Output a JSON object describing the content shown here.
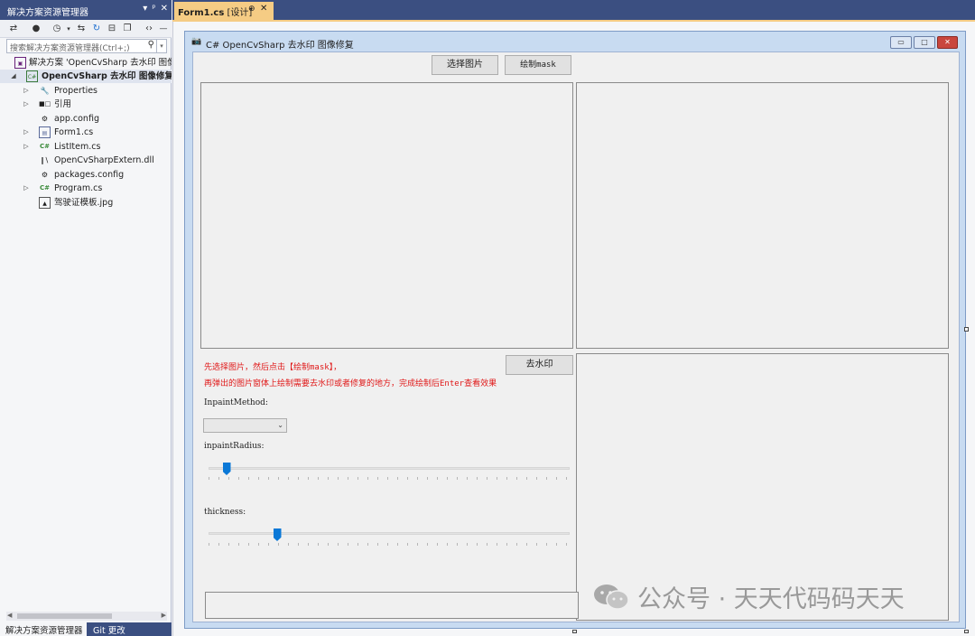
{
  "solution_explorer": {
    "title": "解决方案资源管理器",
    "title_buttons": [
      "▾",
      "ᵖ",
      "✕"
    ],
    "search_placeholder": "搜索解决方案资源管理器(Ctrl+;)",
    "tree": [
      {
        "label": "解决方案 'OpenCvSharp 去水印 图像",
        "icon": "solution-icon"
      },
      {
        "label": "OpenCvSharp 去水印 图像修复",
        "icon": "csharp-project-icon",
        "expanded": true,
        "bold": true
      },
      {
        "label": "Properties",
        "icon": "wrench-icon"
      },
      {
        "label": "引用",
        "icon": "references-icon"
      },
      {
        "label": "app.config",
        "icon": "config-file-icon"
      },
      {
        "label": "Form1.cs",
        "icon": "form-icon"
      },
      {
        "label": "ListItem.cs",
        "icon": "csharp-file-icon"
      },
      {
        "label": "OpenCvSharpExtern.dll",
        "icon": "dll-icon"
      },
      {
        "label": "packages.config",
        "icon": "config-file-icon"
      },
      {
        "label": "Program.cs",
        "icon": "csharp-file-icon"
      },
      {
        "label": "驾驶证模板.jpg",
        "icon": "image-file-icon"
      }
    ],
    "bottom_tabs": [
      "解决方案资源管理器",
      "Git 更改"
    ]
  },
  "document_tab": {
    "file": "Form1.cs",
    "suffix": " [设计]",
    "pin": "⊕",
    "close": "✕"
  },
  "form": {
    "title": "C# OpenCvSharp 去水印 图像修复",
    "window_buttons": [
      "▭",
      "□",
      "✕"
    ],
    "select_image_button": "选择图片",
    "draw_mask_button": "绘制mask",
    "remove_watermark_button": "去水印",
    "hint_line1": "先选择图片，然后点击【绘制mask】，",
    "hint_line2": "再弹出的图片窗体上绘制需要去水印或者修复的地方，完成绘制后Enter查看效果",
    "inpaint_method_label": "InpaintMethod:",
    "inpaint_method_value": "",
    "inpaint_radius_label": "inpaintRadius:",
    "thickness_label": "thickness:",
    "inpaint_radius_fraction": 0.05,
    "thickness_fraction": 0.19,
    "textbox_value": ""
  },
  "watermark": {
    "text": "公众号 · 天天代码码天天"
  },
  "colors": {
    "vs_title": "#3b4f81",
    "doc_tab": "#f5cc84",
    "hint_red": "#e01818",
    "slider_thumb": "#0a78d7"
  }
}
